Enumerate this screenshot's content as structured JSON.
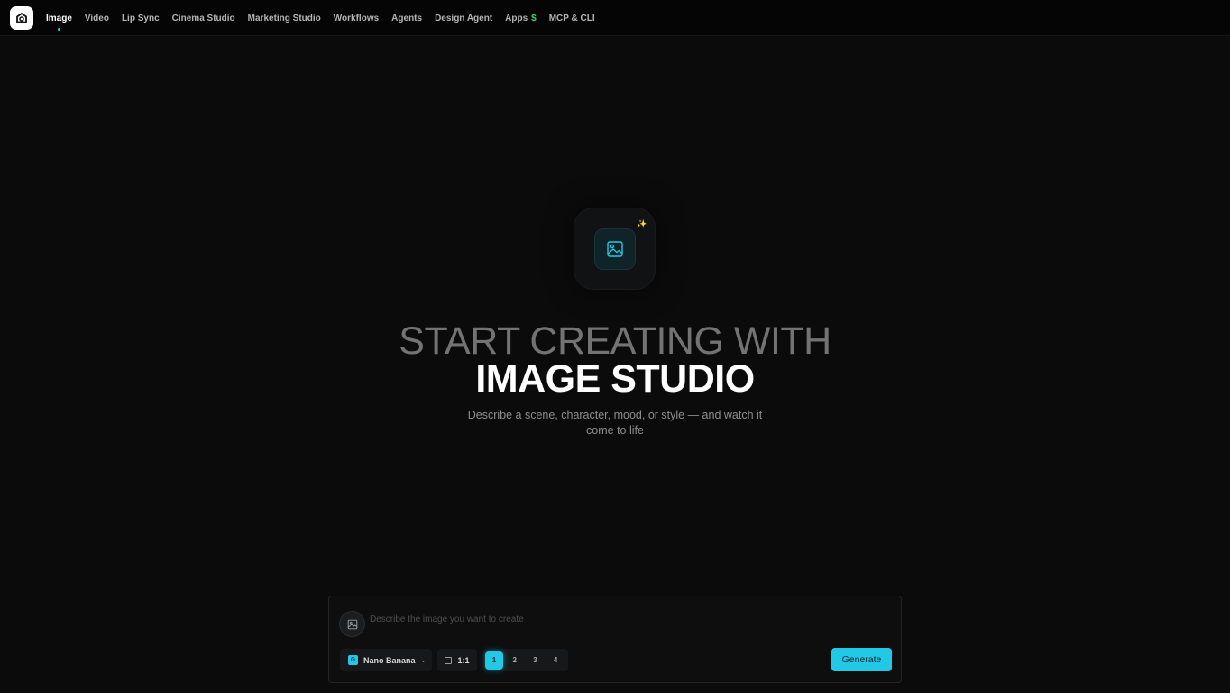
{
  "nav": {
    "items": [
      {
        "label": "Image",
        "active": true
      },
      {
        "label": "Video",
        "active": false
      },
      {
        "label": "Lip Sync",
        "active": false
      },
      {
        "label": "Cinema Studio",
        "active": false
      },
      {
        "label": "Marketing Studio",
        "active": false
      },
      {
        "label": "Workflows",
        "active": false
      },
      {
        "label": "Agents",
        "active": false
      },
      {
        "label": "Design Agent",
        "active": false
      },
      {
        "label": "Apps",
        "active": false,
        "badge": "$"
      },
      {
        "label": "MCP & CLI",
        "active": false
      }
    ]
  },
  "hero": {
    "icon": "image-icon",
    "sparkle_icon": "sparkle-icon",
    "headline_line1": "START CREATING WITH",
    "headline_line2": "IMAGE STUDIO",
    "subtitle": "Describe a scene, character, mood, or style — and watch it come to life"
  },
  "composer": {
    "attach_icon": "image-icon",
    "prompt_placeholder": "Describe the image you want to create",
    "prompt_value": "",
    "model": {
      "label": "Nano Banana",
      "icon_letter": "G"
    },
    "aspect_ratio": "1:1",
    "count_options": [
      "1",
      "2",
      "3",
      "4"
    ],
    "selected_count": "1",
    "generate_label": "Generate"
  },
  "colors": {
    "accent": "#22c9e6",
    "background": "#0b0b0c",
    "apps_badge": "#3ecf6e"
  }
}
